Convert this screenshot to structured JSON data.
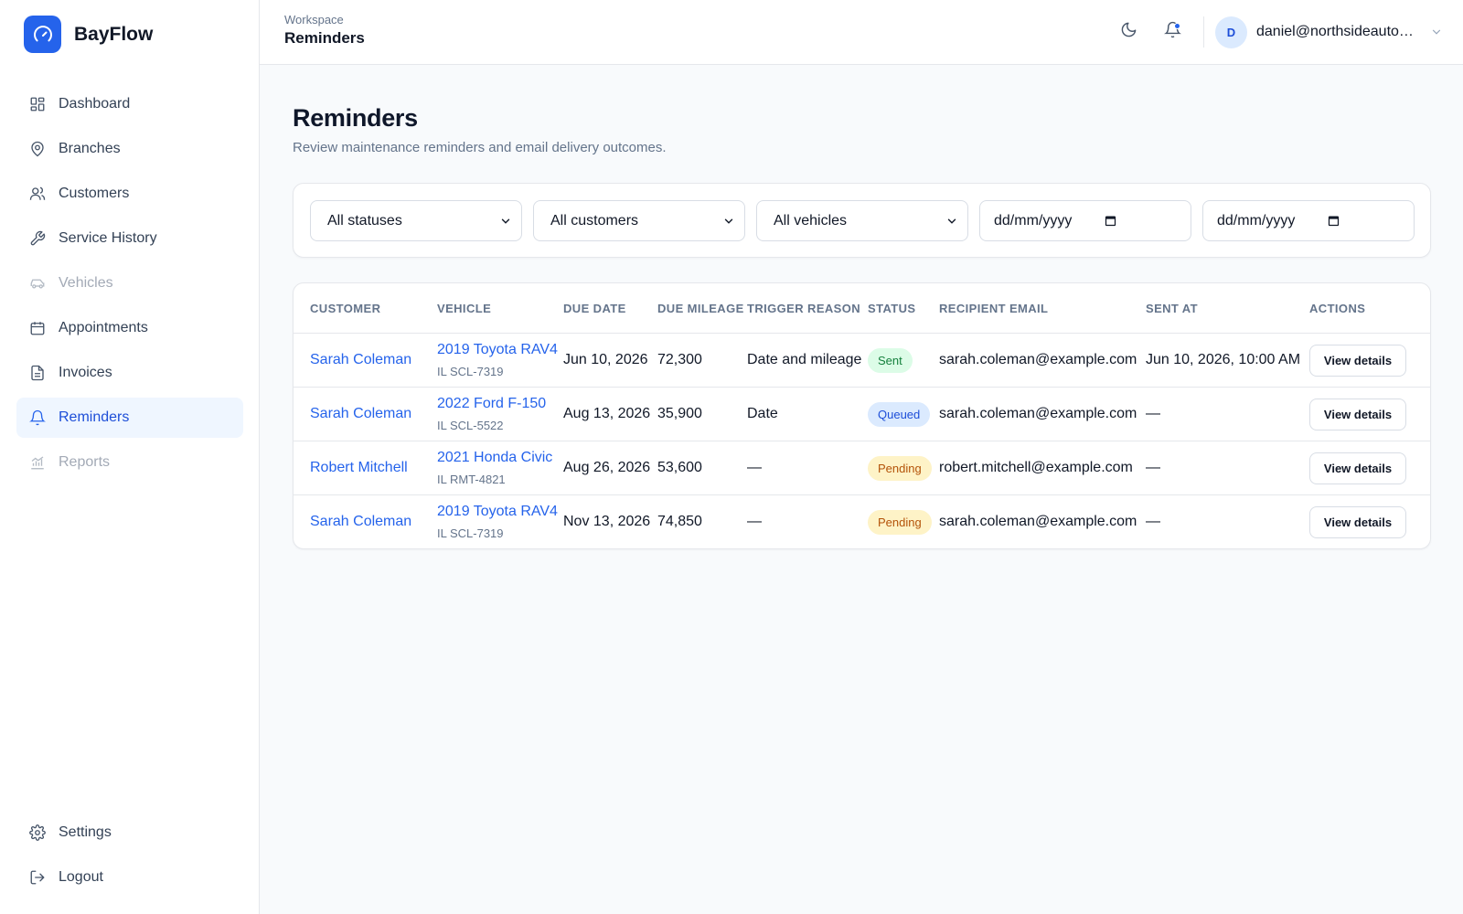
{
  "brand": {
    "name": "BayFlow",
    "color": "#2563eb"
  },
  "sidebar": {
    "items": [
      {
        "label": "Dashboard",
        "icon": "dashboard-icon",
        "state": "normal"
      },
      {
        "label": "Branches",
        "icon": "map-pin-icon",
        "state": "normal"
      },
      {
        "label": "Customers",
        "icon": "users-icon",
        "state": "normal"
      },
      {
        "label": "Service History",
        "icon": "wrench-icon",
        "state": "normal"
      },
      {
        "label": "Vehicles",
        "icon": "car-icon",
        "state": "disabled"
      },
      {
        "label": "Appointments",
        "icon": "calendar-icon",
        "state": "normal"
      },
      {
        "label": "Invoices",
        "icon": "file-icon",
        "state": "normal"
      },
      {
        "label": "Reminders",
        "icon": "bell-icon",
        "state": "active"
      },
      {
        "label": "Reports",
        "icon": "chart-icon",
        "state": "disabled"
      }
    ],
    "bottom": [
      {
        "label": "Settings",
        "icon": "gear-icon"
      },
      {
        "label": "Logout",
        "icon": "logout-icon"
      }
    ]
  },
  "header": {
    "breadcrumb": "Workspace",
    "title": "Reminders",
    "user": {
      "initial": "D",
      "email": "daniel@northsideautomotive.com"
    }
  },
  "main": {
    "title": "Reminders",
    "subtitle": "Review maintenance reminders and email delivery outcomes."
  },
  "filters": {
    "status": "All statuses",
    "customer": "All customers",
    "vehicle": "All vehicles",
    "date_from": "dd/mm/yyyy",
    "date_to": "dd/mm/yyyy"
  },
  "table": {
    "columns": [
      "CUSTOMER",
      "VEHICLE",
      "DUE DATE",
      "DUE MILEAGE",
      "TRIGGER REASON",
      "STATUS",
      "RECIPIENT EMAIL",
      "SENT AT",
      "ACTIONS"
    ],
    "rows": [
      {
        "customer": "Sarah Coleman",
        "vehicle": "2019 Toyota RAV4",
        "plate": "IL SCL-7319",
        "due_date": "Jun 10, 2026",
        "due_mileage": "72,300",
        "trigger": "Date and mileage",
        "status": "Sent",
        "status_kind": "sent",
        "email": "sarah.coleman@example.com",
        "sent_at": "Jun 10, 2026, 10:00 AM",
        "action": "View details"
      },
      {
        "customer": "Sarah Coleman",
        "vehicle": "2022 Ford F-150",
        "plate": "IL SCL-5522",
        "due_date": "Aug 13, 2026",
        "due_mileage": "35,900",
        "trigger": "Date",
        "status": "Queued",
        "status_kind": "queued",
        "email": "sarah.coleman@example.com",
        "sent_at": "—",
        "action": "View details"
      },
      {
        "customer": "Robert Mitchell",
        "vehicle": "2021 Honda Civic",
        "plate": "IL RMT-4821",
        "due_date": "Aug 26, 2026",
        "due_mileage": "53,600",
        "trigger": "—",
        "status": "Pending",
        "status_kind": "pending",
        "email": "robert.mitchell@example.com",
        "sent_at": "—",
        "action": "View details"
      },
      {
        "customer": "Sarah Coleman",
        "vehicle": "2019 Toyota RAV4",
        "plate": "IL SCL-7319",
        "due_date": "Nov 13, 2026",
        "due_mileage": "74,850",
        "trigger": "—",
        "status": "Pending",
        "status_kind": "pending",
        "email": "sarah.coleman@example.com",
        "sent_at": "—",
        "action": "View details"
      }
    ]
  }
}
